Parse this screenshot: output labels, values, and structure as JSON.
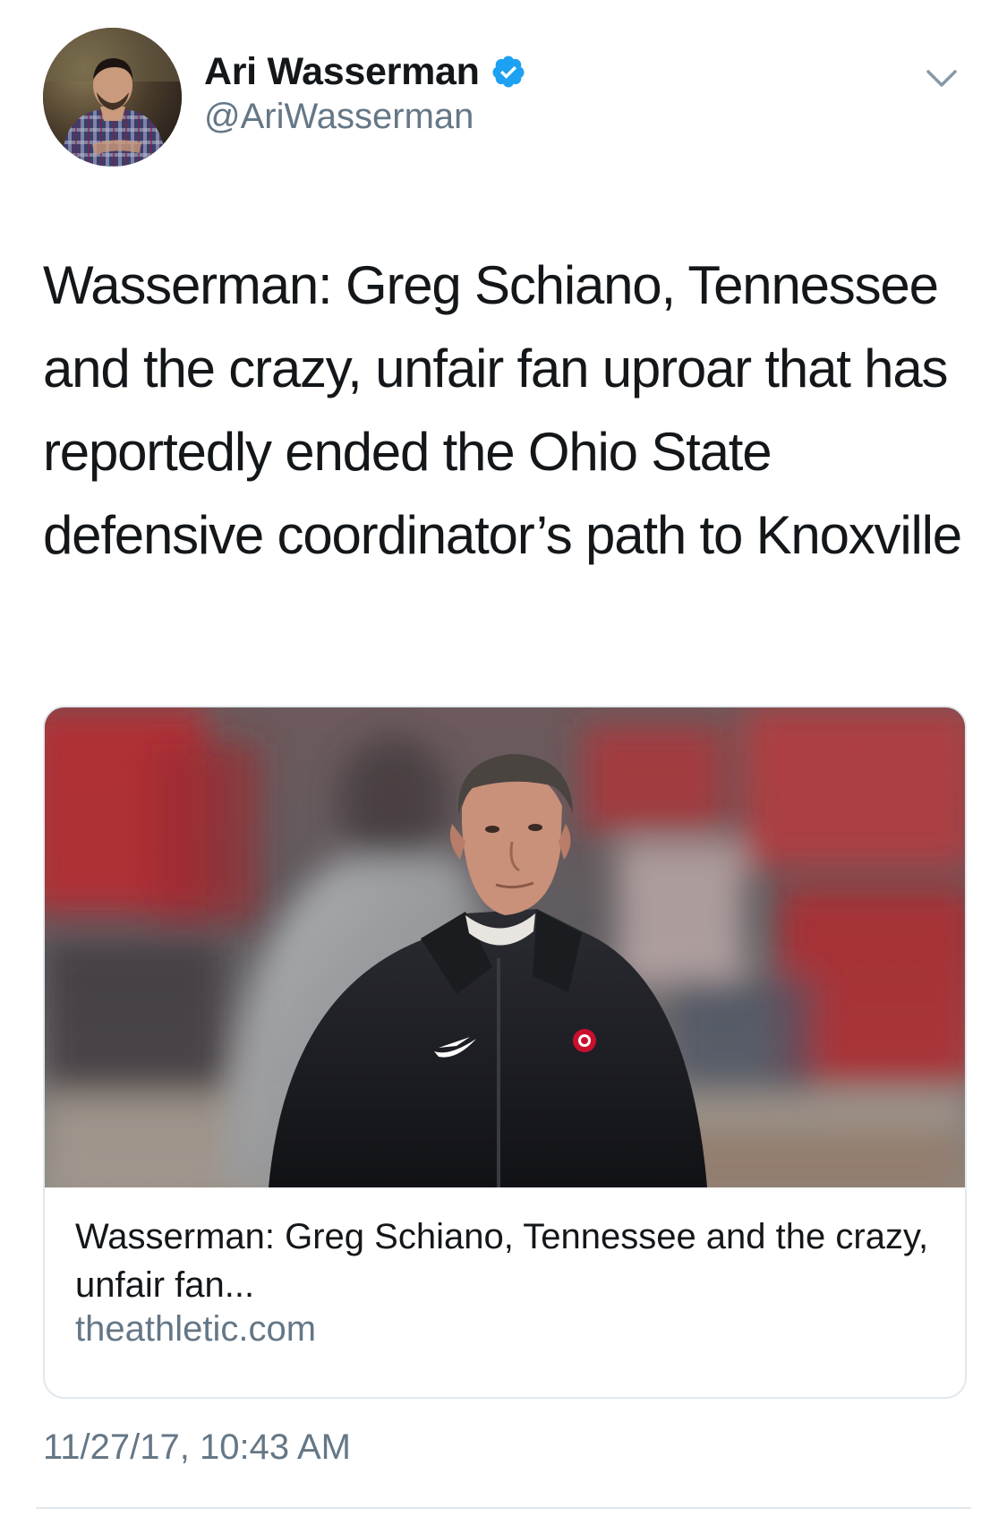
{
  "author": {
    "display_name": "Ari Wasserman",
    "handle": "@AriWasserman",
    "verified": true,
    "avatar_icon": "profile-photo"
  },
  "tweet": {
    "text": "Wasserman: Greg Schiano, Tennessee and the crazy, unfair fan uproar that has reportedly ended the Ohio State defensive coordinator’s path to Knoxville",
    "timestamp": "11/27/17, 10:43 AM"
  },
  "card": {
    "title": "Wasserman: Greg Schiano, Tennessee and the crazy, unfair fan...",
    "domain": "theathletic.com",
    "image_icon": "coach-photo"
  },
  "colors": {
    "text_primary": "#14171a",
    "text_secondary": "#657786",
    "verified_blue": "#1da1f2",
    "border": "#e1e8ed"
  }
}
